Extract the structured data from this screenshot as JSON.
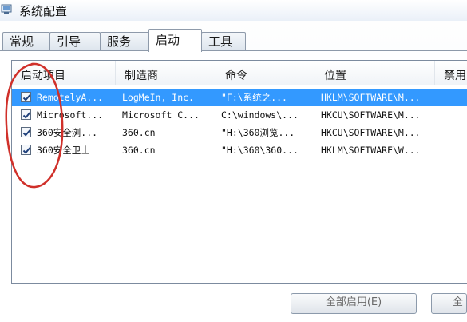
{
  "window": {
    "title": "系统配置",
    "app_icon": "system-config-icon"
  },
  "tabs": [
    {
      "label": "常规"
    },
    {
      "label": "引导"
    },
    {
      "label": "服务"
    },
    {
      "label": "启动",
      "active": true
    },
    {
      "label": "工具"
    }
  ],
  "columns": [
    "启动项目",
    "制造商",
    "命令",
    "位置",
    "禁用"
  ],
  "rows": [
    {
      "checked": true,
      "selected": true,
      "item": "RemotelyA...",
      "maker": "LogMeIn, Inc.",
      "command": "\"F:\\系统之...",
      "location": "HKLM\\SOFTWARE\\M..."
    },
    {
      "checked": true,
      "selected": false,
      "item": "Microsoft...",
      "maker": "Microsoft C...",
      "command": "C:\\windows\\...",
      "location": "HKCU\\SOFTWARE\\M..."
    },
    {
      "checked": true,
      "selected": false,
      "item": "360安全浏...",
      "maker": "360.cn",
      "command": "\"H:\\360浏览...",
      "location": "HKCU\\SOFTWARE\\M..."
    },
    {
      "checked": true,
      "selected": false,
      "item": "360安全卫士",
      "maker": "360.cn",
      "command": "\"H:\\360\\360...",
      "location": "HKLM\\SOFTWARE\\W..."
    }
  ],
  "buttons": {
    "enable_all": "全部启用(E)",
    "next": "全"
  },
  "colors": {
    "selection": "#3399ff",
    "annotation": "#d0302a"
  }
}
